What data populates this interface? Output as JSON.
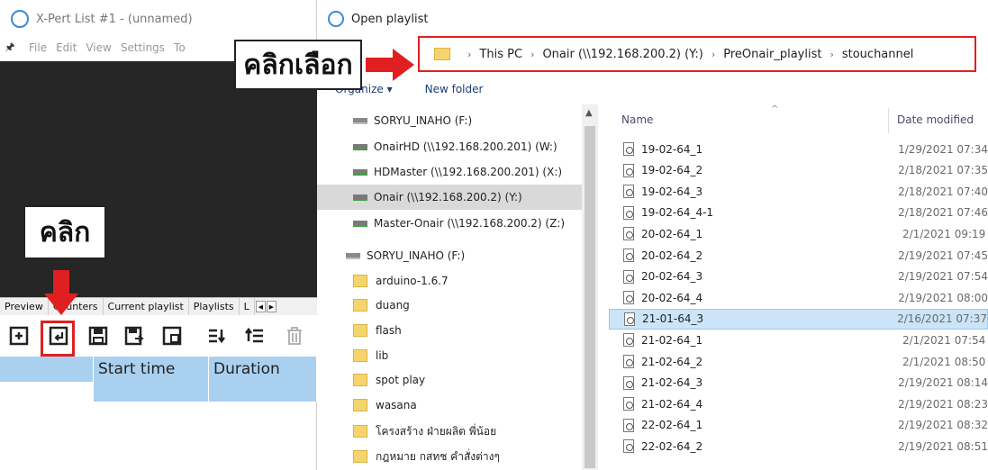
{
  "app": {
    "title": "X-Pert List #1 - (unnamed)",
    "menu": [
      "File",
      "Edit",
      "View",
      "Settings",
      "To"
    ],
    "tabs": [
      "Preview",
      "Counters",
      "Current playlist",
      "Playlists",
      "L"
    ],
    "columns": [
      "",
      "Start time",
      "Duration"
    ],
    "toolbar_icons": [
      "new-playlist-icon",
      "open-playlist-icon",
      "save-icon",
      "save-as-icon",
      "export-icon",
      "move-down-icon",
      "move-up-icon",
      "delete-icon"
    ]
  },
  "explorer": {
    "title": "Open playlist",
    "address": [
      "This PC",
      "Onair (\\\\192.168.200.2) (Y:)",
      "PreOnair_playlist",
      "stouchannel"
    ],
    "organize": "Organize ▾",
    "new_folder": "New folder",
    "nav_items": [
      {
        "label": "SORYU_INAHO (F:)",
        "icon": "drive-icon"
      },
      {
        "label": "OnairHD (\\\\192.168.200.201) (W:)",
        "icon": "network-drive-icon"
      },
      {
        "label": "HDMaster (\\\\192.168.200.201) (X:)",
        "icon": "network-drive-icon"
      },
      {
        "label": "Onair (\\\\192.168.200.2) (Y:)",
        "icon": "network-drive-icon",
        "selected": true
      },
      {
        "label": "Master-Onair (\\\\192.168.200.2) (Z:)",
        "icon": "network-drive-icon"
      },
      {
        "label": "SORYU_INAHO (F:)",
        "icon": "drive-icon"
      },
      {
        "label": "arduino-1.6.7",
        "icon": "folder-icon"
      },
      {
        "label": "duang",
        "icon": "folder-icon"
      },
      {
        "label": "flash",
        "icon": "folder-icon"
      },
      {
        "label": "lib",
        "icon": "folder-icon"
      },
      {
        "label": "spot play",
        "icon": "folder-icon"
      },
      {
        "label": "wasana",
        "icon": "folder-icon"
      },
      {
        "label": "โครงสร้าง ฝ่ายผลิต พี่น้อย",
        "icon": "folder-icon"
      },
      {
        "label": "กฎหมาย กสทช คำสั่งต่างๆ",
        "icon": "folder-icon"
      }
    ],
    "columns": {
      "name": "Name",
      "date": "Date modified"
    },
    "files": [
      {
        "name": "19-02-64_1",
        "date": "1/29/2021 07:34"
      },
      {
        "name": "19-02-64_2",
        "date": "2/18/2021 07:35"
      },
      {
        "name": "19-02-64_3",
        "date": "2/18/2021 07:40"
      },
      {
        "name": "19-02-64_4-1",
        "date": "2/18/2021 07:46"
      },
      {
        "name": "20-02-64_1",
        "date": "2/1/2021 09:19"
      },
      {
        "name": "20-02-64_2",
        "date": "2/19/2021 07:45"
      },
      {
        "name": "20-02-64_3",
        "date": "2/19/2021 07:54"
      },
      {
        "name": "20-02-64_4",
        "date": "2/19/2021 08:00"
      },
      {
        "name": "21-01-64_3",
        "date": "2/16/2021 07:37",
        "selected": true
      },
      {
        "name": "21-02-64_1",
        "date": "2/1/2021 07:54"
      },
      {
        "name": "21-02-64_2",
        "date": "2/1/2021 08:50"
      },
      {
        "name": "21-02-64_3",
        "date": "2/19/2021 08:14"
      },
      {
        "name": "21-02-64_4",
        "date": "2/19/2021 08:23"
      },
      {
        "name": "22-02-64_1",
        "date": "2/19/2021 08:32"
      },
      {
        "name": "22-02-64_2",
        "date": "2/19/2021 08:51"
      }
    ]
  },
  "annotations": {
    "select_label": "คลิกเลือก",
    "click_label": "คลิก",
    "highlight_color": "#e02020"
  }
}
